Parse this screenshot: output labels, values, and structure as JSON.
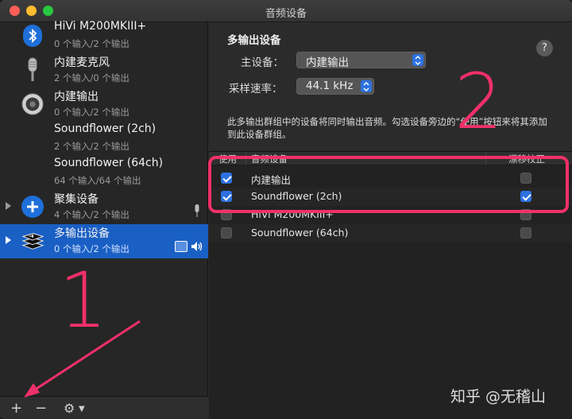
{
  "window": {
    "title": "音频设备"
  },
  "sidebar": {
    "devices": [
      {
        "name": "HiVi M200MKIII+",
        "sub": "0 个输入/2 个输出",
        "icon": "bluetooth-icon"
      },
      {
        "name": "内建麦克风",
        "sub": "2 个输入/0 个输出",
        "icon": "microphone-icon"
      },
      {
        "name": "内建输出",
        "sub": "0 个输入/2 个输出",
        "icon": "speaker-icon"
      },
      {
        "name": "Soundflower (2ch)",
        "sub": "2 个输入/2 个输出",
        "icon": ""
      },
      {
        "name": "Soundflower (64ch)",
        "sub": "64 个输入/64 个输出",
        "icon": ""
      },
      {
        "name": "聚集设备",
        "sub": "4 个输入/2 个输出",
        "icon": "plus-badge-icon"
      },
      {
        "name": "多输出设备",
        "sub": "0 个输入/2 个输出",
        "icon": "multi-output-icon"
      }
    ],
    "footer": {
      "add": "+",
      "remove": "−",
      "action": "⚙"
    }
  },
  "annotations": {
    "one": "1",
    "two": "2"
  },
  "pane": {
    "title": "多输出设备",
    "master_label": "主设备：",
    "master_value": "内建输出",
    "rate_label": "采样速率：",
    "rate_value": "44.1 kHz",
    "help": "?",
    "description": "此多输出群组中的设备将同时输出音频。勾选设备旁边的“使用”按钮来将其添加到此设备群组。",
    "table": {
      "headers": {
        "use": "使用",
        "device": "音频设备",
        "drift": "漂移校正"
      },
      "rows": [
        {
          "name": "内建输出",
          "use": true,
          "drift": false
        },
        {
          "name": "Soundflower (2ch)",
          "use": true,
          "drift": true
        },
        {
          "name": "HiVi M200MKIII+",
          "use": false,
          "drift": false
        },
        {
          "name": "Soundflower (64ch)",
          "use": false,
          "drift": false
        }
      ]
    }
  },
  "watermark": "知乎 @无稽山",
  "colors": {
    "accent": "#2d72e0",
    "selection": "#1a5fc4",
    "annotation": "#f0306a"
  }
}
